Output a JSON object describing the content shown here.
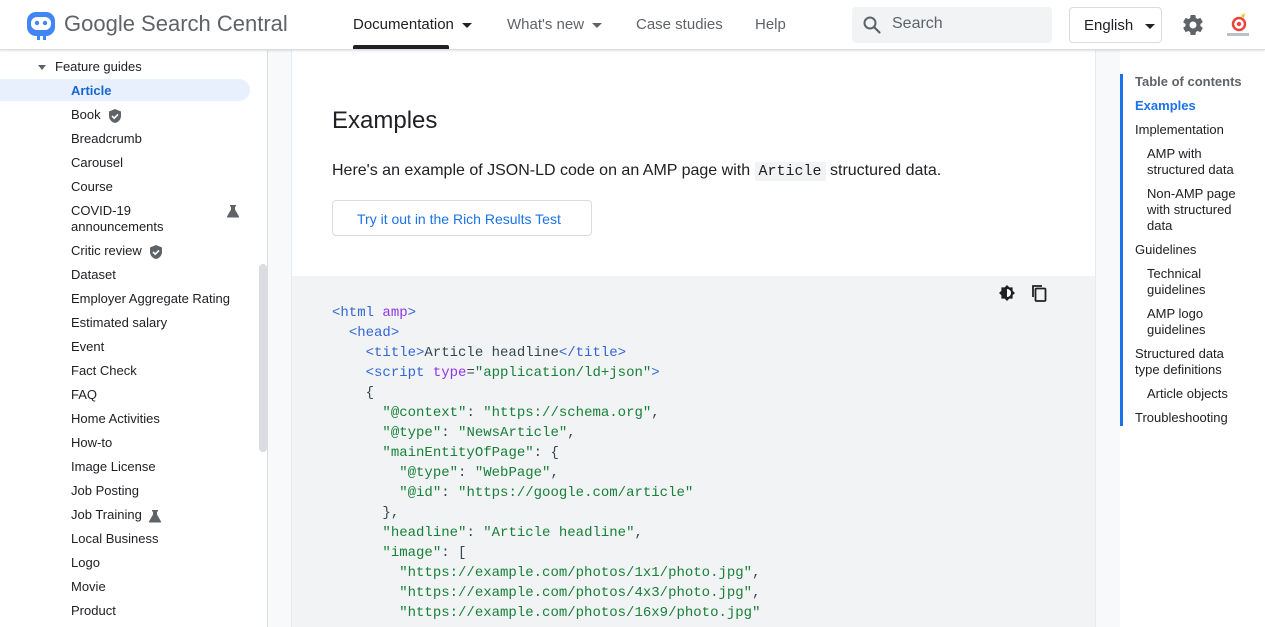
{
  "header": {
    "brand": "Google Search Central",
    "nav": [
      "Documentation",
      "What's new",
      "Case studies",
      "Help"
    ],
    "search_placeholder": "Search",
    "language": "English",
    "colors": {
      "accent": "#1a73e8",
      "active_bg": "#e8f0fe"
    }
  },
  "sidebar": {
    "section": "Feature guides",
    "items": [
      {
        "label": "Article",
        "active": true
      },
      {
        "label": "Book",
        "badge": "shield-icon"
      },
      {
        "label": "Breadcrumb"
      },
      {
        "label": "Carousel"
      },
      {
        "label": "Course"
      },
      {
        "label": "COVID-19 announcements",
        "badge": "flask-icon"
      },
      {
        "label": "Critic review",
        "badge": "shield-icon"
      },
      {
        "label": "Dataset"
      },
      {
        "label": "Employer Aggregate Rating"
      },
      {
        "label": "Estimated salary"
      },
      {
        "label": "Event"
      },
      {
        "label": "Fact Check"
      },
      {
        "label": "FAQ"
      },
      {
        "label": "Home Activities"
      },
      {
        "label": "How-to"
      },
      {
        "label": "Image License"
      },
      {
        "label": "Job Posting"
      },
      {
        "label": "Job Training",
        "badge": "flask-icon"
      },
      {
        "label": "Local Business"
      },
      {
        "label": "Logo"
      },
      {
        "label": "Movie"
      },
      {
        "label": "Product"
      }
    ]
  },
  "main": {
    "heading": "Examples",
    "intro_before": "Here's an example of JSON-LD code on an AMP page with ",
    "intro_code": "Article",
    "intro_after": " structured data.",
    "try_button": "Try it out in the Rich Results Test",
    "code": {
      "l1_tag": "<html",
      "l1_attr": "amp",
      "l1_end": ">",
      "l2": "<head>",
      "l3_open": "<title>",
      "l3_text": "Article headline",
      "l3_close": "</title>",
      "l4_tag": "<script",
      "l4_attr": "type",
      "l4_eq": "=",
      "l4_val": "\"application/ld+json\"",
      "l4_end": ">",
      "l5": "{",
      "l6_key": "\"@context\"",
      "l6_val": "\"https://schema.org\"",
      "l7_key": "\"@type\"",
      "l7_val": "\"NewsArticle\"",
      "l8_key": "\"mainEntityOfPage\"",
      "l8_rest": ": {",
      "l9_key": "\"@type\"",
      "l9_val": "\"WebPage\"",
      "l10_key": "\"@id\"",
      "l10_val": "\"https://google.com/article\"",
      "l11": "},",
      "l12_key": "\"headline\"",
      "l12_val": "\"Article headline\"",
      "l13_key": "\"image\"",
      "l13_rest": ": [",
      "l14": "\"https://example.com/photos/1x1/photo.jpg\"",
      "l15": "\"https://example.com/photos/4x3/photo.jpg\"",
      "l16": "\"https://example.com/photos/16x9/photo.jpg\"",
      "sep": ": ",
      "comma": ","
    }
  },
  "toc": {
    "title": "Table of contents",
    "items": [
      {
        "label": "Examples",
        "active": true
      },
      {
        "label": "Implementation"
      },
      {
        "label": "AMP with structured data"
      },
      {
        "label": "Non-AMP page with structured data"
      },
      {
        "label": "Guidelines"
      },
      {
        "label": "Technical guidelines"
      },
      {
        "label": "AMP logo guidelines"
      },
      {
        "label": "Structured data type definitions"
      },
      {
        "label": "Article objects"
      },
      {
        "label": "Troubleshooting"
      }
    ]
  }
}
